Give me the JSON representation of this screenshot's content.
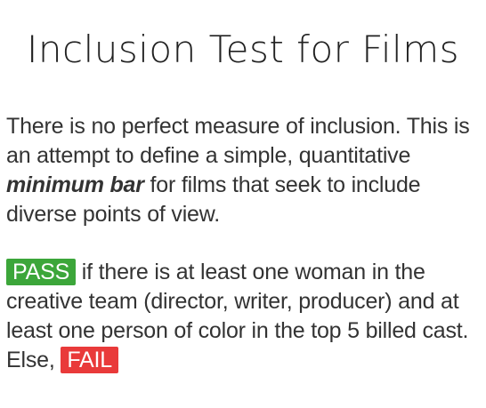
{
  "title": "Inclusion Test for Films",
  "intro": {
    "part1": "There is no perfect measure of inclusion. This is an attempt to define a simple, quantitative ",
    "emphasis": "minimum bar",
    "part2": " for films that seek to include diverse points of view."
  },
  "rule": {
    "pass_badge": "PASS",
    "text1": " if there is at least one woman in the creative team (director, writer, producer) and at least one person of color in the top 5 billed cast. Else, ",
    "fail_badge": "FAIL"
  },
  "colors": {
    "pass": "#3ca63a",
    "fail": "#e93a3a",
    "text": "#333333"
  }
}
